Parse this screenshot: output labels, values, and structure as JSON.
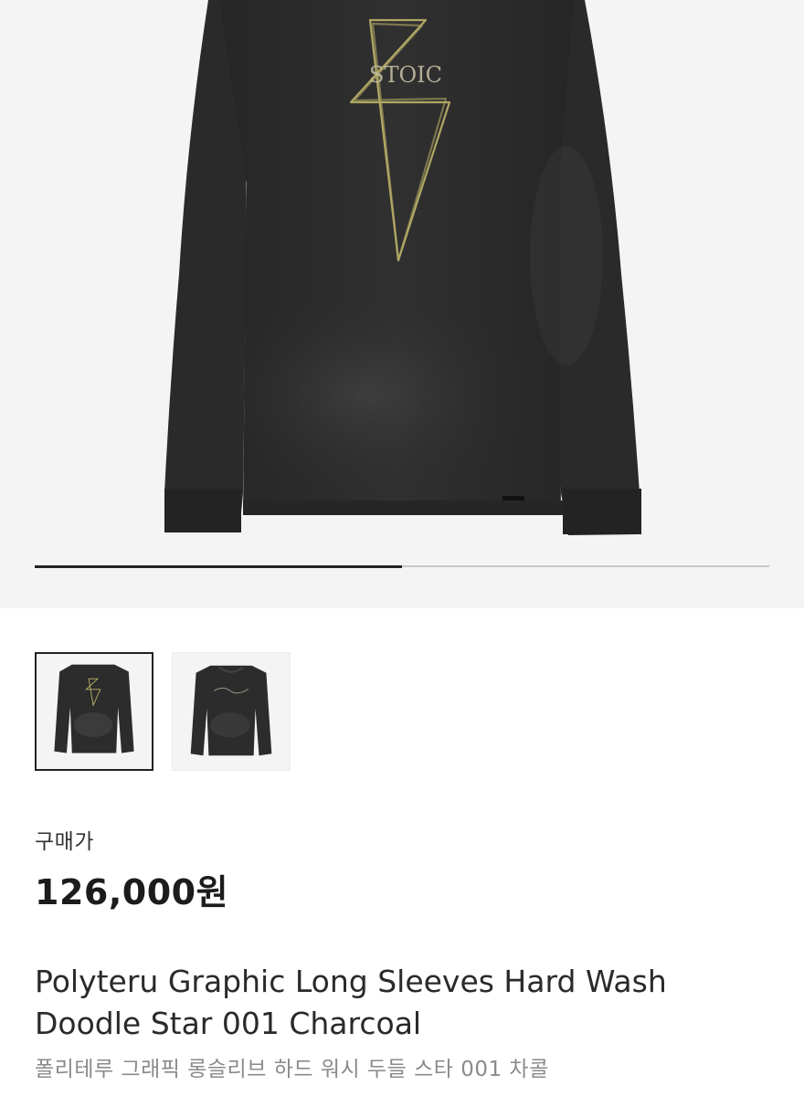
{
  "gallery": {
    "progress": 0.5,
    "print_text": "STOIC",
    "thumbnails": [
      {
        "icon": "sweatshirt-front-thumbnail",
        "selected": true
      },
      {
        "icon": "sweatshirt-back-thumbnail",
        "selected": false
      }
    ]
  },
  "product": {
    "price_label": "구매가",
    "price": "126,000원",
    "name_en": "Polyteru Graphic Long Sleeves Hard Wash Doodle Star 001 Charcoal",
    "name_ko": "폴리테루 그래픽 롱슬리브 하드 워시 두들 스타 001 차콜"
  },
  "colors": {
    "hero_background": "#f4f4f4",
    "garment": "#2b2b2b",
    "print": "#bfb46a",
    "progress_fill": "#222222",
    "progress_track": "#c9c9c9"
  }
}
